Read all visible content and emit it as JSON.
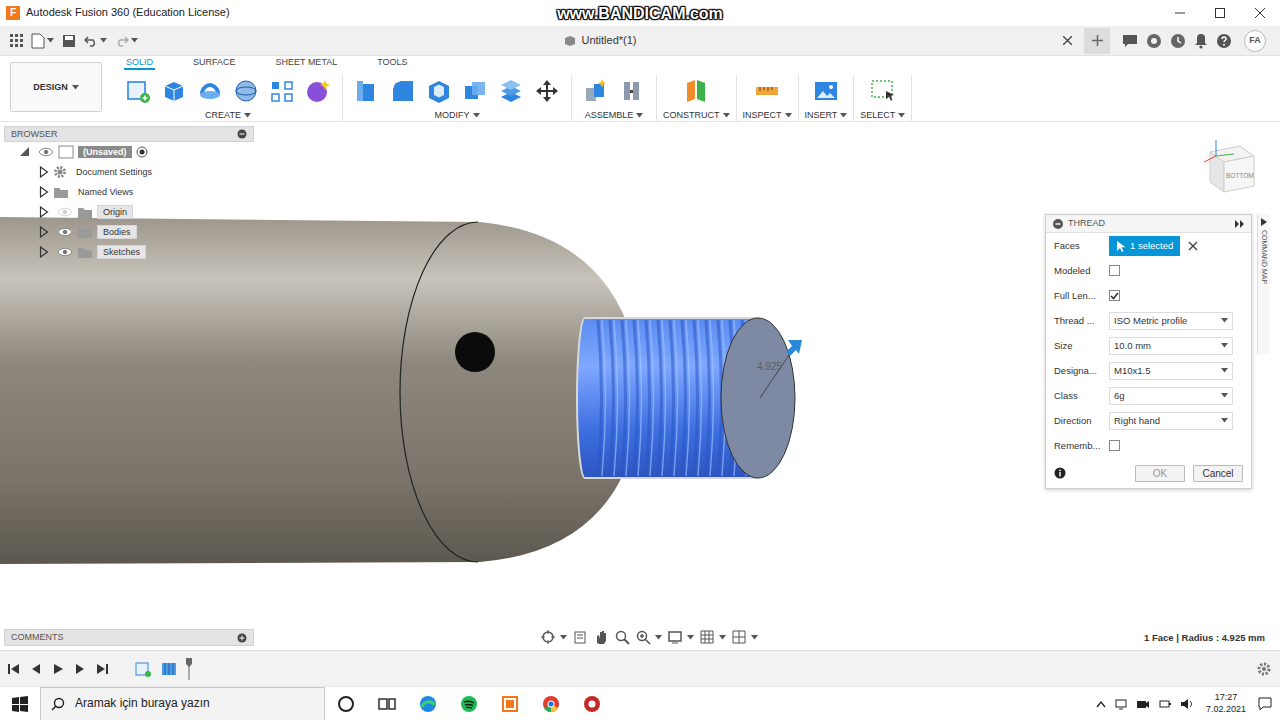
{
  "window": {
    "logo": "F",
    "title": "Autodesk Fusion 360 (Education License)",
    "watermark": "www.BANDICAM.com"
  },
  "document": {
    "tab": {
      "label": "Untitled*(1)",
      "selected": true
    },
    "user": "FA"
  },
  "toolbar": {
    "workspace": "DESIGN",
    "tabs": [
      {
        "label": "SOLID",
        "selected": true
      },
      {
        "label": "SURFACE",
        "selected": false
      },
      {
        "label": "SHEET METAL",
        "selected": false
      },
      {
        "label": "TOOLS",
        "selected": false
      }
    ],
    "groups": [
      {
        "label": "CREATE"
      },
      {
        "label": "MODIFY"
      },
      {
        "label": "ASSEMBLE"
      },
      {
        "label": "CONSTRUCT"
      },
      {
        "label": "INSPECT"
      },
      {
        "label": "INSERT"
      },
      {
        "label": "SELECT"
      }
    ]
  },
  "browser": {
    "title": "BROWSER",
    "items": [
      {
        "label": "(Unsaved)",
        "kind": "root",
        "expanded": true,
        "visible": true
      },
      {
        "label": "Document Settings",
        "kind": "settings",
        "expanded": false
      },
      {
        "label": "Named Views",
        "kind": "folder",
        "expanded": false
      },
      {
        "label": "Origin",
        "kind": "folder",
        "expanded": false,
        "visible": false
      },
      {
        "label": "Bodies",
        "kind": "folder",
        "expanded": false,
        "visible": true
      },
      {
        "label": "Sketches",
        "kind": "folder",
        "expanded": false,
        "visible": true
      }
    ]
  },
  "viewport": {
    "dimension": "4.925",
    "viewcube": "BOTTOM"
  },
  "thread_dialog": {
    "title": "THREAD",
    "side_tab": "COMMAND MAP",
    "rows": [
      {
        "label": "Faces",
        "kind": "selection",
        "value": "1 selected",
        "active": true
      },
      {
        "label": "Modeled",
        "kind": "checkbox",
        "checked": false
      },
      {
        "label": "Full Len...",
        "kind": "checkbox",
        "checked": true
      },
      {
        "label": "Thread ...",
        "kind": "dropdown",
        "value": "ISO Metric profile"
      },
      {
        "label": "Size",
        "kind": "dropdown",
        "value": "10.0 mm"
      },
      {
        "label": "Designa...",
        "kind": "dropdown",
        "value": "M10x1.5"
      },
      {
        "label": "Class",
        "kind": "dropdown",
        "value": "6g"
      },
      {
        "label": "Direction",
        "kind": "dropdown",
        "value": "Right hand"
      },
      {
        "label": "Rememb...",
        "kind": "checkbox",
        "checked": false
      }
    ],
    "buttons": [
      {
        "label": "OK",
        "disabled": true
      },
      {
        "label": "Cancel",
        "disabled": false
      }
    ]
  },
  "comments": {
    "title": "COMMENTS"
  },
  "status_bar": "1 Face | Radius : 4.925 mm",
  "taskbar": {
    "search": {
      "placeholder": "Aramak için buraya yazın"
    },
    "time": "17:27",
    "date": "7.02.2021"
  }
}
